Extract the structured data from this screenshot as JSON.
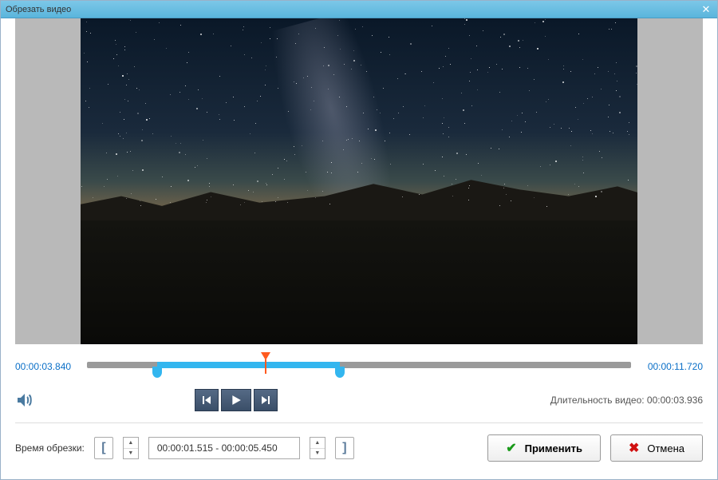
{
  "window": {
    "title": "Обрезать видео"
  },
  "timeline": {
    "current_time": "00:00:03.840",
    "total_time": "00:00:11.720",
    "sel_start_pct": 12.9,
    "sel_end_pct": 46.5,
    "playhead_pct": 32.8
  },
  "controls": {
    "duration_label": "Длительность видео: ",
    "duration_value": "00:00:03.936"
  },
  "trim": {
    "label": "Время обрезки:",
    "range_text": "00:00:01.515 - 00:00:05.450"
  },
  "buttons": {
    "apply": "Применить",
    "cancel": "Отмена"
  }
}
